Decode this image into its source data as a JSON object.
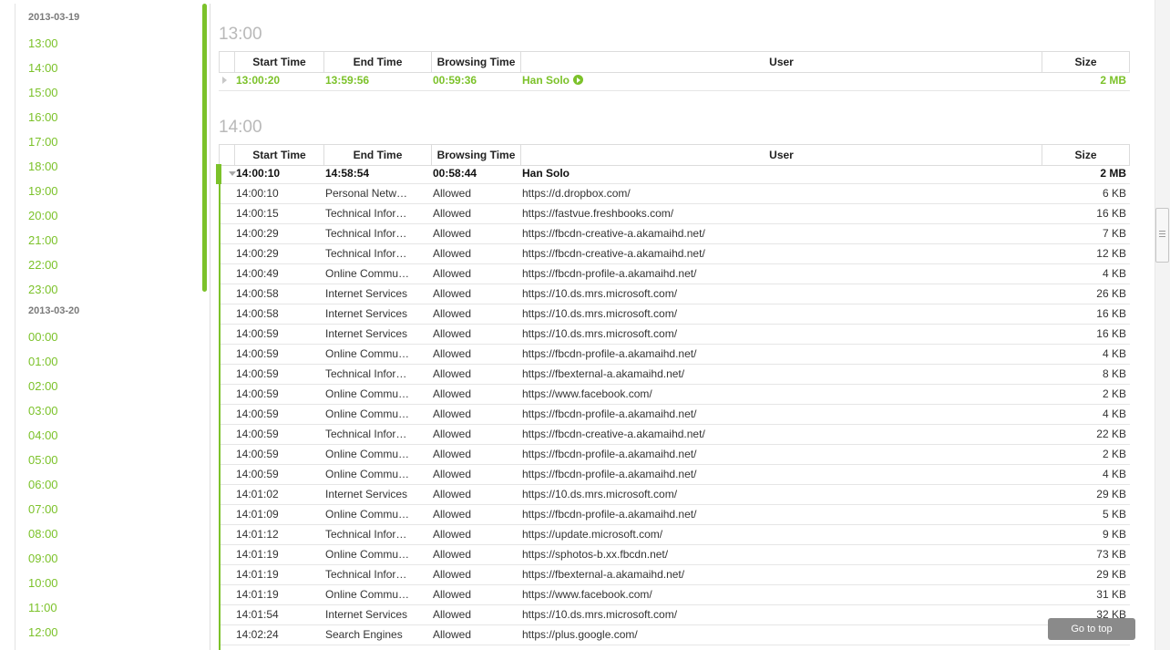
{
  "sidebar": {
    "entries": [
      {
        "type": "date",
        "label": "2013-03-19"
      },
      {
        "type": "hour",
        "label": "13:00"
      },
      {
        "type": "hour",
        "label": "14:00"
      },
      {
        "type": "hour",
        "label": "15:00"
      },
      {
        "type": "hour",
        "label": "16:00"
      },
      {
        "type": "hour",
        "label": "17:00"
      },
      {
        "type": "hour",
        "label": "18:00"
      },
      {
        "type": "hour",
        "label": "19:00"
      },
      {
        "type": "hour",
        "label": "20:00"
      },
      {
        "type": "hour",
        "label": "21:00"
      },
      {
        "type": "hour",
        "label": "22:00"
      },
      {
        "type": "hour",
        "label": "23:00"
      },
      {
        "type": "date",
        "label": "2013-03-20"
      },
      {
        "type": "hour",
        "label": "00:00"
      },
      {
        "type": "hour",
        "label": "01:00"
      },
      {
        "type": "hour",
        "label": "02:00"
      },
      {
        "type": "hour",
        "label": "03:00"
      },
      {
        "type": "hour",
        "label": "04:00"
      },
      {
        "type": "hour",
        "label": "05:00"
      },
      {
        "type": "hour",
        "label": "06:00"
      },
      {
        "type": "hour",
        "label": "07:00"
      },
      {
        "type": "hour",
        "label": "08:00"
      },
      {
        "type": "hour",
        "label": "09:00"
      },
      {
        "type": "hour",
        "label": "10:00"
      },
      {
        "type": "hour",
        "label": "11:00"
      },
      {
        "type": "hour",
        "label": "12:00"
      }
    ]
  },
  "columns": {
    "start": "Start Time",
    "end": "End Time",
    "browsing": "Browsing Time",
    "user": "User",
    "size": "Size"
  },
  "sections": [
    {
      "title": "13:00",
      "summary": {
        "start": "13:00:20",
        "end": "13:59:56",
        "browsing": "00:59:36",
        "user": "Han Solo",
        "size": "2 MB"
      }
    },
    {
      "title": "14:00",
      "summary": {
        "start": "14:00:10",
        "end": "14:58:54",
        "browsing": "00:58:44",
        "user": "Han Solo",
        "size": "2 MB"
      },
      "details": [
        {
          "time": "14:00:10",
          "category": "Personal Netw…",
          "status": "Allowed",
          "url": "https://d.dropbox.com/",
          "size": "6 KB"
        },
        {
          "time": "14:00:15",
          "category": "Technical Infor…",
          "status": "Allowed",
          "url": "https://fastvue.freshbooks.com/",
          "size": "16 KB"
        },
        {
          "time": "14:00:29",
          "category": "Technical Infor…",
          "status": "Allowed",
          "url": "https://fbcdn-creative-a.akamaihd.net/",
          "size": "7 KB"
        },
        {
          "time": "14:00:29",
          "category": "Technical Infor…",
          "status": "Allowed",
          "url": "https://fbcdn-creative-a.akamaihd.net/",
          "size": "12 KB"
        },
        {
          "time": "14:00:49",
          "category": "Online Commu…",
          "status": "Allowed",
          "url": "https://fbcdn-profile-a.akamaihd.net/",
          "size": "4 KB"
        },
        {
          "time": "14:00:58",
          "category": "Internet Services",
          "status": "Allowed",
          "url": "https://10.ds.mrs.microsoft.com/",
          "size": "26 KB"
        },
        {
          "time": "14:00:58",
          "category": "Internet Services",
          "status": "Allowed",
          "url": "https://10.ds.mrs.microsoft.com/",
          "size": "16 KB"
        },
        {
          "time": "14:00:59",
          "category": "Internet Services",
          "status": "Allowed",
          "url": "https://10.ds.mrs.microsoft.com/",
          "size": "16 KB"
        },
        {
          "time": "14:00:59",
          "category": "Online Commu…",
          "status": "Allowed",
          "url": "https://fbcdn-profile-a.akamaihd.net/",
          "size": "4 KB"
        },
        {
          "time": "14:00:59",
          "category": "Technical Infor…",
          "status": "Allowed",
          "url": "https://fbexternal-a.akamaihd.net/",
          "size": "8 KB"
        },
        {
          "time": "14:00:59",
          "category": "Online Commu…",
          "status": "Allowed",
          "url": "https://www.facebook.com/",
          "size": "2 KB"
        },
        {
          "time": "14:00:59",
          "category": "Online Commu…",
          "status": "Allowed",
          "url": "https://fbcdn-profile-a.akamaihd.net/",
          "size": "4 KB"
        },
        {
          "time": "14:00:59",
          "category": "Technical Infor…",
          "status": "Allowed",
          "url": "https://fbcdn-creative-a.akamaihd.net/",
          "size": "22 KB"
        },
        {
          "time": "14:00:59",
          "category": "Online Commu…",
          "status": "Allowed",
          "url": "https://fbcdn-profile-a.akamaihd.net/",
          "size": "2 KB"
        },
        {
          "time": "14:00:59",
          "category": "Online Commu…",
          "status": "Allowed",
          "url": "https://fbcdn-profile-a.akamaihd.net/",
          "size": "4 KB"
        },
        {
          "time": "14:01:02",
          "category": "Internet Services",
          "status": "Allowed",
          "url": "https://10.ds.mrs.microsoft.com/",
          "size": "29 KB"
        },
        {
          "time": "14:01:09",
          "category": "Online Commu…",
          "status": "Allowed",
          "url": "https://fbcdn-profile-a.akamaihd.net/",
          "size": "5 KB"
        },
        {
          "time": "14:01:12",
          "category": "Technical Infor…",
          "status": "Allowed",
          "url": "https://update.microsoft.com/",
          "size": "9 KB"
        },
        {
          "time": "14:01:19",
          "category": "Online Commu…",
          "status": "Allowed",
          "url": "https://sphotos-b.xx.fbcdn.net/",
          "size": "73 KB"
        },
        {
          "time": "14:01:19",
          "category": "Technical Infor…",
          "status": "Allowed",
          "url": "https://fbexternal-a.akamaihd.net/",
          "size": "29 KB"
        },
        {
          "time": "14:01:19",
          "category": "Online Commu…",
          "status": "Allowed",
          "url": "https://www.facebook.com/",
          "size": "31 KB"
        },
        {
          "time": "14:01:54",
          "category": "Internet Services",
          "status": "Allowed",
          "url": "https://10.ds.mrs.microsoft.com/",
          "size": "32 KB"
        },
        {
          "time": "14:02:24",
          "category": "Search Engines",
          "status": "Allowed",
          "url": "https://plus.google.com/",
          "size": ""
        }
      ]
    }
  ],
  "go_top_label": "Go to top",
  "icons": {
    "play": "play-circle-icon",
    "expand": "expand-arrow-icon",
    "collapse": "collapse-arrow-icon"
  },
  "colors": {
    "accent": "#7cc22a",
    "muted": "#b9b9b9"
  }
}
